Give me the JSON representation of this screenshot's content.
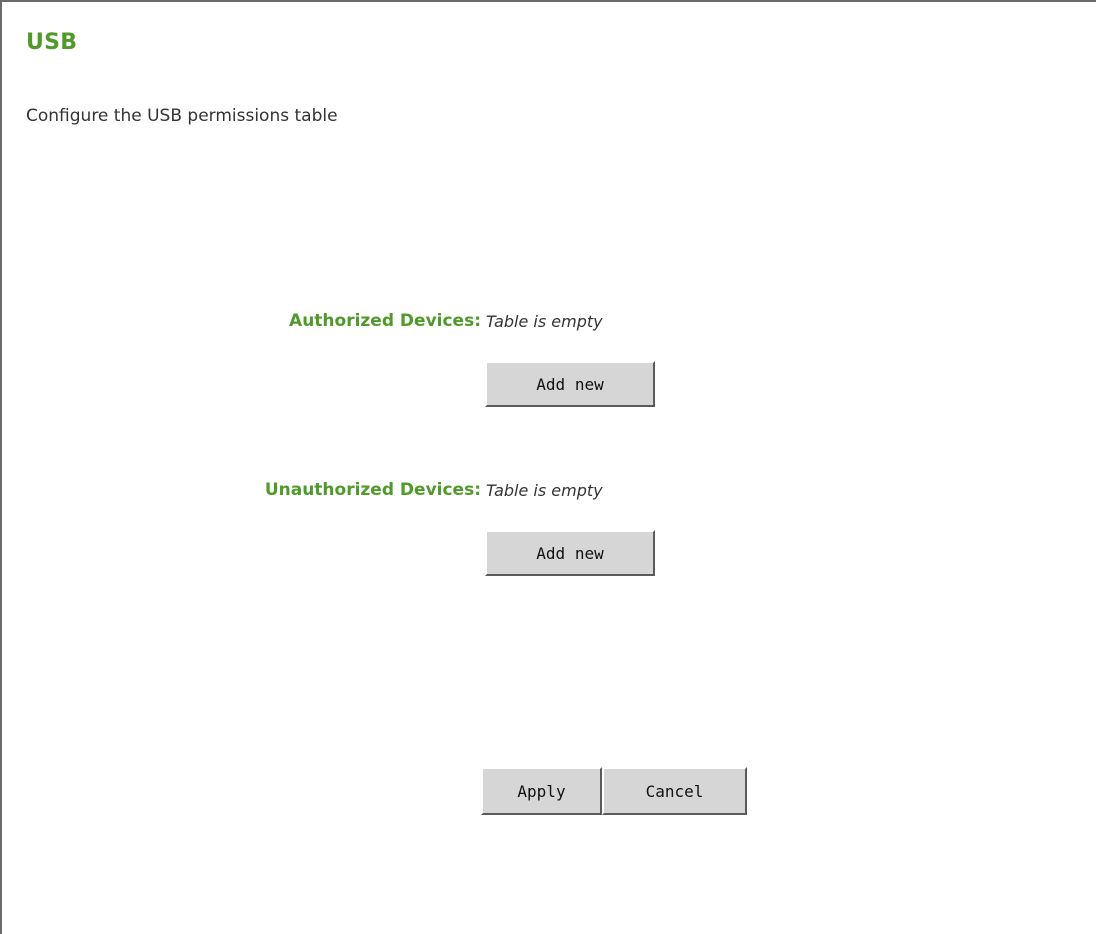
{
  "page": {
    "title": "USB",
    "description": "Configure the USB permissions table"
  },
  "authorized": {
    "label": "Authorized Devices:",
    "value": "Table is empty",
    "add_label": "Add new"
  },
  "unauthorized": {
    "label": "Unauthorized Devices:",
    "value": "Table is empty",
    "add_label": "Add new"
  },
  "actions": {
    "apply_label": "Apply",
    "cancel_label": "Cancel"
  },
  "colors": {
    "accent": "#4f9a2a",
    "button_face": "#d6d6d6"
  }
}
